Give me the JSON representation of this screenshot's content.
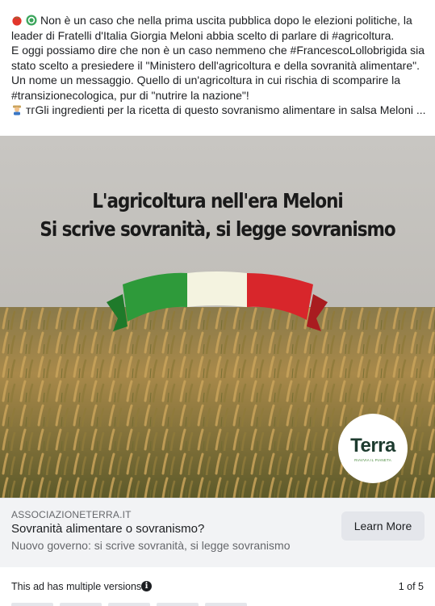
{
  "post": {
    "line1": "Non è un caso che nella prima uscita pubblica dopo le elezioni politiche, la",
    "line2": "leader di Fratelli d'Italia Giorgia Meloni abbia scelto di parlare di #agricoltura.",
    "line3": "E oggi possiamo dire che non è un caso nemmeno che #FrancescoLollobrigida sia",
    "line4": "stato scelto a presiedere il \"Ministero dell'agricoltura e della sovranità alimentare\".",
    "line5": "Un nome un messaggio. Quello di un'agricoltura in cui rischia di scomparire la",
    "line6": "#transizionecologica, pur di \"nutrire la nazione\"!",
    "line7": "Gli ingredienti per la ricetta di questo sovranismo alimentare in salsa Meloni ...",
    "line7_prefix": "тг"
  },
  "creative": {
    "headline1": "L'agricoltura nell'era Meloni",
    "headline2": "Si scrive sovranità, si legge sovranismo",
    "logo_word": "Terra",
    "logo_sub": "RIAVVIA IL PIANETA",
    "flag_colors": [
      "#2e9a3a",
      "#f4f3e0",
      "#d8262b"
    ]
  },
  "link": {
    "domain": "ASSOCIAZIONETERRA.IT",
    "title": "Sovranità alimentare o sovranismo?",
    "description": "Nuovo governo: si scrive sovranità, si legge sovranismo",
    "cta": "Learn More"
  },
  "footer": {
    "versions_text": "This ad has multiple versions",
    "info_icon": "info-icon",
    "pager": "1 of 5"
  }
}
